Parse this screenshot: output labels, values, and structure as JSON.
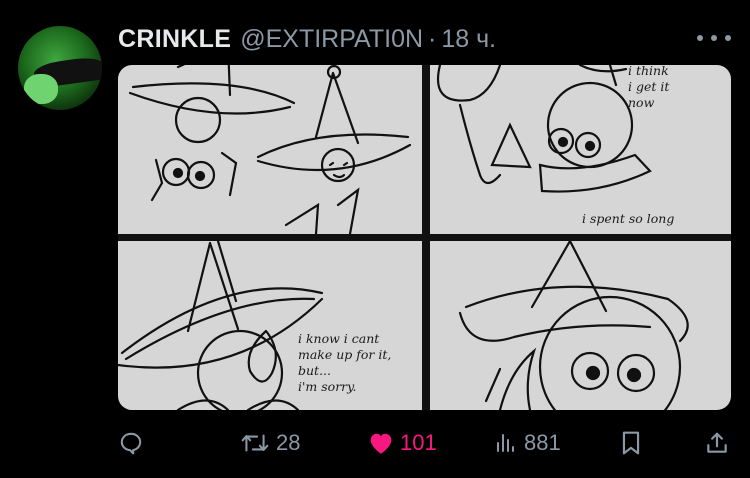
{
  "tweet": {
    "author_name": "CRINKLE",
    "handle": "@EXTIRPATI0N",
    "separator": "·",
    "time": "18 ч.",
    "media": {
      "panels": [
        {
          "text": "i think\ni get it\nnow"
        },
        {
          "text": "i spent so long"
        },
        {
          "text": "i know i cant\nmake up for it,\nbut...\n i'm sorry."
        }
      ]
    }
  },
  "actions": {
    "retweets": "28",
    "likes": "101",
    "views": "881"
  },
  "colors": {
    "background": "#000000",
    "text": "#e7e9ea",
    "muted": "#8b98a5",
    "like": "#f91880"
  },
  "icons": [
    "more-icon",
    "reply-icon",
    "retweet-icon",
    "heart-icon",
    "views-icon",
    "bookmark-icon",
    "share-icon"
  ]
}
